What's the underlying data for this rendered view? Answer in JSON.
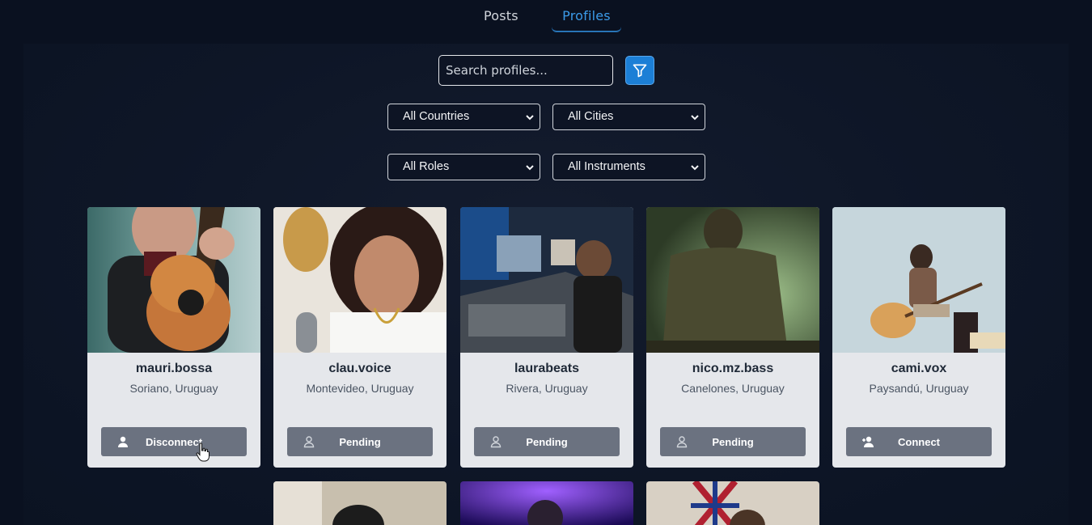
{
  "tabs": [
    {
      "label": "Posts",
      "active": false
    },
    {
      "label": "Profiles",
      "active": true
    }
  ],
  "search": {
    "placeholder": "Search profiles...",
    "value": ""
  },
  "filters": {
    "country": "All Countries",
    "city": "All Cities",
    "role": "All Roles",
    "instrument": "All Instruments"
  },
  "icons": {
    "filter": "filter-icon",
    "user": "user-icon",
    "user_add": "user-add-icon"
  },
  "colors": {
    "accent": "#1c7fd6",
    "tab_active": "#3b9ae8",
    "card_bg": "#e5e7eb",
    "button_bg": "#6b7280"
  },
  "profiles": [
    {
      "name": "mauri.bossa",
      "location": "Soriano, Uruguay",
      "action": "Disconnect"
    },
    {
      "name": "clau.voice",
      "location": "Montevideo, Uruguay",
      "action": "Pending"
    },
    {
      "name": "laurabeats",
      "location": "Rivera, Uruguay",
      "action": "Pending"
    },
    {
      "name": "nico.mz.bass",
      "location": "Canelones, Uruguay",
      "action": "Pending"
    },
    {
      "name": "cami.vox",
      "location": "Paysandú, Uruguay",
      "action": "Connect"
    }
  ]
}
